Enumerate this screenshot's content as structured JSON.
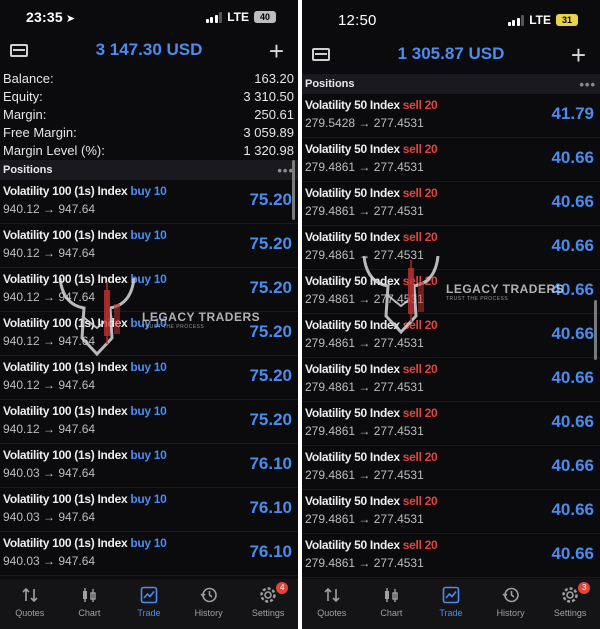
{
  "left": {
    "status": {
      "time": "23:35",
      "network": "LTE",
      "battery": "40"
    },
    "header": {
      "balance": "3 147.30 USD"
    },
    "account": [
      {
        "label": "Balance:",
        "value": "163.20"
      },
      {
        "label": "Equity:",
        "value": "3 310.50"
      },
      {
        "label": "Margin:",
        "value": "250.61"
      },
      {
        "label": "Free Margin:",
        "value": "3 059.89"
      },
      {
        "label": "Margin Level (%):",
        "value": "1 320.98"
      }
    ],
    "section_title": "Positions",
    "positions": [
      {
        "symbol": "Volatility 100 (1s) Index",
        "side": "buy 10",
        "prices": "940.12 → 947.64",
        "profit": "75.20"
      },
      {
        "symbol": "Volatility 100 (1s) Index",
        "side": "buy 10",
        "prices": "940.12 → 947.64",
        "profit": "75.20"
      },
      {
        "symbol": "Volatility 100 (1s) Index",
        "side": "buy 10",
        "prices": "940.12 → 947.64",
        "profit": "75.20"
      },
      {
        "symbol": "Volatility 100 (1s) Index",
        "side": "buy 10",
        "prices": "940.12 → 947.64",
        "profit": "75.20"
      },
      {
        "symbol": "Volatility 100 (1s) Index",
        "side": "buy 10",
        "prices": "940.12 → 947.64",
        "profit": "75.20"
      },
      {
        "symbol": "Volatility 100 (1s) Index",
        "side": "buy 10",
        "prices": "940.12 → 947.64",
        "profit": "75.20"
      },
      {
        "symbol": "Volatility 100 (1s) Index",
        "side": "buy 10",
        "prices": "940.03 → 947.64",
        "profit": "76.10"
      },
      {
        "symbol": "Volatility 100 (1s) Index",
        "side": "buy 10",
        "prices": "940.03 → 947.64",
        "profit": "76.10"
      },
      {
        "symbol": "Volatility 100 (1s) Index",
        "side": "buy 10",
        "prices": "940.03 → 947.64",
        "profit": "76.10"
      }
    ],
    "tabs": [
      {
        "label": "Quotes",
        "icon": "quotes-icon",
        "badge": ""
      },
      {
        "label": "Chart",
        "icon": "chart-icon",
        "badge": ""
      },
      {
        "label": "Trade",
        "icon": "trade-icon",
        "badge": ""
      },
      {
        "label": "History",
        "icon": "history-icon",
        "badge": ""
      },
      {
        "label": "Settings",
        "icon": "settings-icon",
        "badge": "4"
      }
    ]
  },
  "right": {
    "status": {
      "time": "12:50",
      "network": "LTE",
      "battery": "31"
    },
    "header": {
      "balance": "1 305.87 USD"
    },
    "section_title": "Positions",
    "positions": [
      {
        "symbol": "Volatility 50 Index",
        "side": "sell 20",
        "prices": "279.5428 → 277.4531",
        "profit": "41.79"
      },
      {
        "symbol": "Volatility 50 Index",
        "side": "sell 20",
        "prices": "279.4861 → 277.4531",
        "profit": "40.66"
      },
      {
        "symbol": "Volatility 50 Index",
        "side": "sell 20",
        "prices": "279.4861 → 277.4531",
        "profit": "40.66"
      },
      {
        "symbol": "Volatility 50 Index",
        "side": "sell 20",
        "prices": "279.4861 → 277.4531",
        "profit": "40.66"
      },
      {
        "symbol": "Volatility 50 Index",
        "side": "sell 20",
        "prices": "279.4861 → 277.4531",
        "profit": "40.66"
      },
      {
        "symbol": "Volatility 50 Index",
        "side": "sell 20",
        "prices": "279.4861 → 277.4531",
        "profit": "40.66"
      },
      {
        "symbol": "Volatility 50 Index",
        "side": "sell 20",
        "prices": "279.4861 → 277.4531",
        "profit": "40.66"
      },
      {
        "symbol": "Volatility 50 Index",
        "side": "sell 20",
        "prices": "279.4861 → 277.4531",
        "profit": "40.66"
      },
      {
        "symbol": "Volatility 50 Index",
        "side": "sell 20",
        "prices": "279.4861 → 277.4531",
        "profit": "40.66"
      },
      {
        "symbol": "Volatility 50 Index",
        "side": "sell 20",
        "prices": "279.4861 → 277.4531",
        "profit": "40.66"
      },
      {
        "symbol": "Volatility 50 Index",
        "side": "sell 20",
        "prices": "279.4861 → 277.4531",
        "profit": "40.66"
      }
    ],
    "tabs": [
      {
        "label": "Quotes",
        "icon": "quotes-icon",
        "badge": ""
      },
      {
        "label": "Chart",
        "icon": "chart-icon",
        "badge": ""
      },
      {
        "label": "Trade",
        "icon": "trade-icon",
        "badge": ""
      },
      {
        "label": "History",
        "icon": "history-icon",
        "badge": ""
      },
      {
        "label": "Settings",
        "icon": "settings-icon",
        "badge": "3"
      }
    ]
  },
  "watermark": {
    "name": "LEGACY TRADERS",
    "tagline": "TRUST THE PROCESS"
  },
  "colors": {
    "accent": "#4a8cf0",
    "sell": "#e0453d",
    "background": "#0b0b0d"
  }
}
